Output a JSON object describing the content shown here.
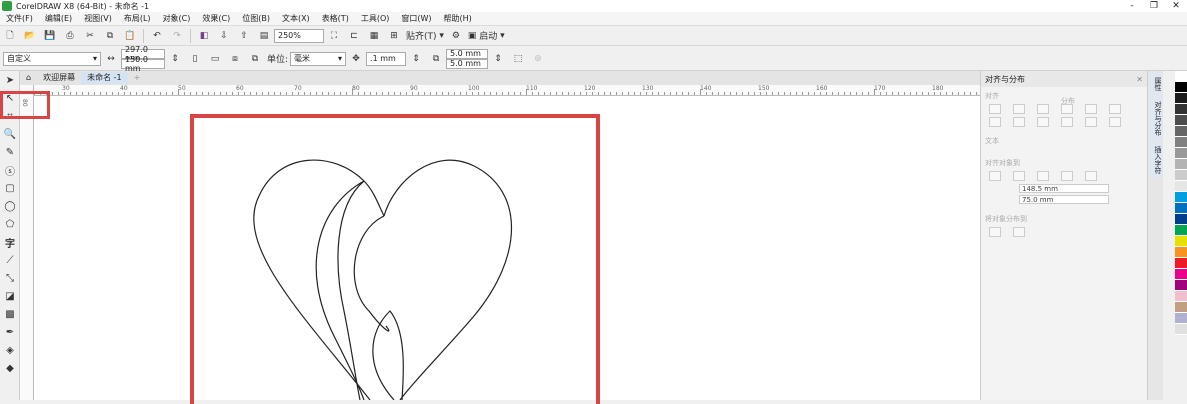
{
  "app": {
    "title": "CorelDRAW X8 (64-Bit) - 未命名 -1"
  },
  "window_controls": [
    "‑",
    "❐",
    "✕"
  ],
  "menu": [
    "文件(F)",
    "编辑(E)",
    "视图(V)",
    "布局(L)",
    "对象(C)",
    "效果(C)",
    "位图(B)",
    "文本(X)",
    "表格(T)",
    "工具(O)",
    "窗口(W)",
    "帮助(H)"
  ],
  "toolbar1": {
    "zoom": "250%",
    "snap_label": "贴齐(T)",
    "launch_label": "启动"
  },
  "toolbar2": {
    "preset": "自定义",
    "width": "297.0 mm",
    "height": "150.0 mm",
    "unit_label": "单位:",
    "unit_value": "毫米",
    "nudge": ".1 mm",
    "dup_x": "5.0 mm",
    "dup_y": "5.0 mm"
  },
  "tabs": [
    {
      "label": "欢迎屏幕",
      "active": false
    },
    {
      "label": "未命名 -1",
      "active": true
    }
  ],
  "ruler": {
    "h_ticks": [
      "30",
      "40",
      "50",
      "60",
      "70",
      "80",
      "90",
      "100",
      "110",
      "120",
      "130",
      "140",
      "150",
      "160",
      "170",
      "180"
    ],
    "v_ticks": [
      "80"
    ]
  },
  "dock": {
    "title": "对齐与分布",
    "sections": {
      "align": "对齐",
      "distribute": "分布",
      "text": "文本",
      "align_objects_to": "对齐对象到",
      "distribute_to": "将对象分布到"
    },
    "x": "148.5 mm",
    "y": "75.0 mm"
  },
  "side_tabs": [
    "属性",
    "对齐与分布",
    "插入字符"
  ],
  "palette_colors": [
    "#ffffff",
    "#000000",
    "#1a1a1a",
    "#333333",
    "#4d4d4d",
    "#666666",
    "#808080",
    "#999999",
    "#b3b3b3",
    "#cccccc",
    "#e6e6e6",
    "#00a0e0",
    "#0070c0",
    "#003f8a",
    "#00a651",
    "#e8e000",
    "#f7941d",
    "#ed1c24",
    "#ec008c",
    "#a0007c",
    "#f0c0d0",
    "#c0a080",
    "#b0b0d0",
    "#e0e0e0"
  ]
}
